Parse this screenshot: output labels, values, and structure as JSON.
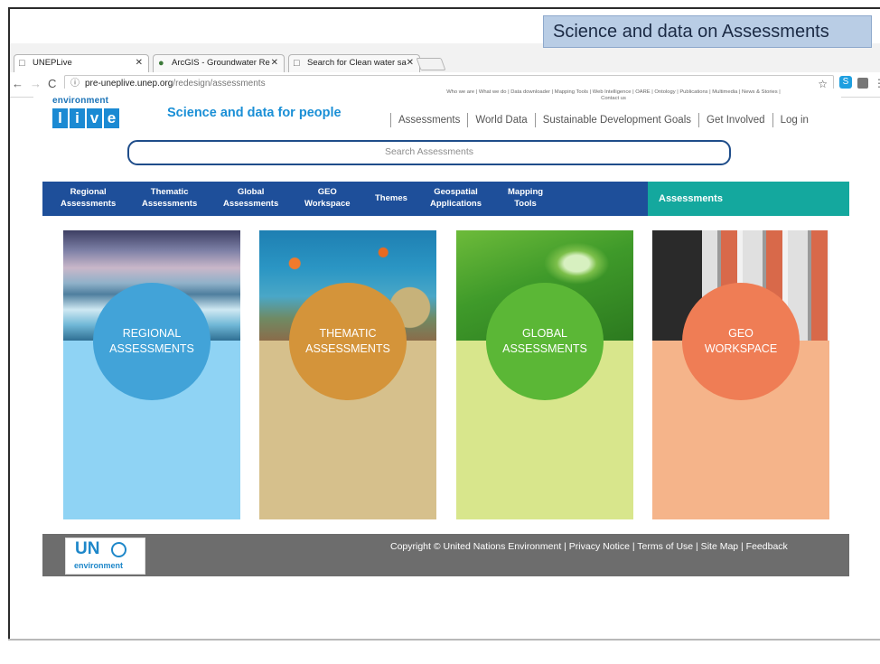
{
  "slide": {
    "title": "Science and data on Assessments"
  },
  "browser": {
    "tabs": [
      {
        "title": "UNEPLive",
        "icon": "page-icon"
      },
      {
        "title": "ArcGIS - Groundwater Re",
        "icon": "globe-icon"
      },
      {
        "title": "Search for Clean water sa",
        "icon": "page-icon"
      }
    ],
    "url_host": "pre-uneplive.unep.org",
    "url_path": "/redesign/assessments"
  },
  "site": {
    "logo_top": "environment",
    "logo_letters": [
      "l",
      "i",
      "v",
      "e"
    ],
    "tagline": "Science and data for people",
    "util_links_line1": "Who we are | What we do | Data downloader | Mapping Tools | Web Intelligence | OARE | Ontology | Publications | Multimedia | News & Stories |",
    "util_links_line2": "Contact us",
    "main_links": [
      "Assessments",
      "World Data",
      "Sustainable Development Goals",
      "Get Involved",
      "Log in"
    ],
    "search_placeholder": "Search Assessments",
    "nav": [
      {
        "line1": "Regional",
        "line2": "Assessments"
      },
      {
        "line1": "Thematic",
        "line2": "Assessments"
      },
      {
        "line1": "Global",
        "line2": "Assessments"
      },
      {
        "line1": "GEO",
        "line2": "Workspace"
      },
      {
        "line1": "Themes",
        "line2": ""
      },
      {
        "line1": "Geospatial",
        "line2": "Applications"
      },
      {
        "line1": "Mapping",
        "line2": "Tools"
      }
    ],
    "nav_active": "Assessments",
    "cards": [
      {
        "line1": "REGIONAL",
        "line2": "ASSESSMENTS",
        "circle_color": "#42a3d8",
        "bottom_color": "#8fd3f4"
      },
      {
        "line1": "THEMATIC",
        "line2": "ASSESSMENTS",
        "circle_color": "#d4943a",
        "bottom_color": "#d6c08c"
      },
      {
        "line1": "GLOBAL",
        "line2": "ASSESSMENTS",
        "circle_color": "#5bb736",
        "bottom_color": "#d8e68c"
      },
      {
        "line1": "GEO",
        "line2": "WORKSPACE",
        "circle_color": "#ef7d55",
        "bottom_color": "#f5b48a"
      }
    ],
    "footer": {
      "un_text": "UN",
      "un_sub": "environment",
      "copyright": "Copyright © United Nations Environment | Privacy Notice | Terms of Use | Site Map | Feedback"
    }
  }
}
